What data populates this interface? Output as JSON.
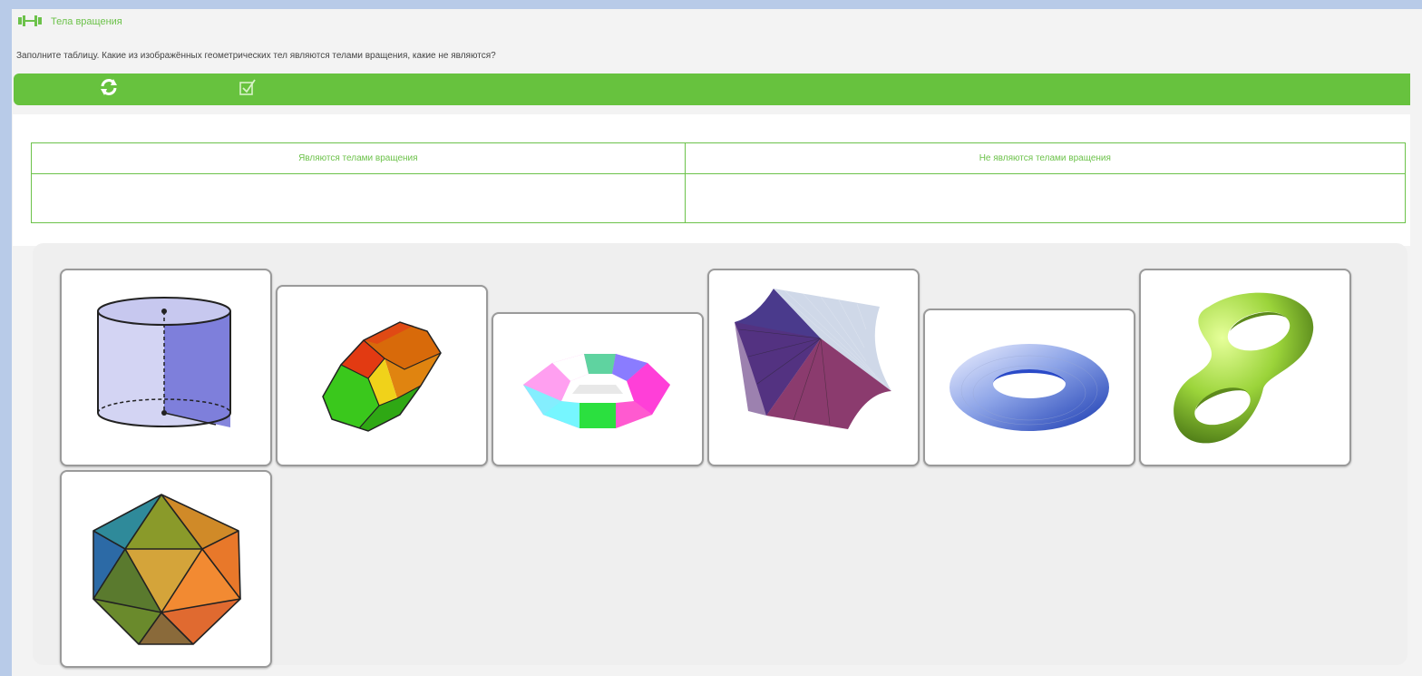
{
  "header": {
    "title": "Тела вращения",
    "instruction": "Заполните таблицу. Какие из изображённых геометрических тел являются телами вращения, какие не являются?"
  },
  "toolbar": {
    "items": [
      {
        "icon": "refresh-icon"
      },
      {
        "icon": "check-icon"
      }
    ]
  },
  "table": {
    "headers": [
      "Являются телами вращения",
      "Не являются телами вращения"
    ]
  },
  "cards": [
    {
      "icon": "cylinder-icon"
    },
    {
      "icon": "hexagonal-prism-icon"
    },
    {
      "icon": "polygonal-ring-icon"
    },
    {
      "icon": "double-cone-icon"
    },
    {
      "icon": "torus-icon"
    },
    {
      "icon": "double-torus-icon"
    },
    {
      "icon": "icosahedron-icon"
    }
  ],
  "colors": {
    "accent": "#67c23e",
    "table_border": "#6cc24a",
    "background": "#f3f3f3",
    "page_edge": "#b8cbe8"
  }
}
